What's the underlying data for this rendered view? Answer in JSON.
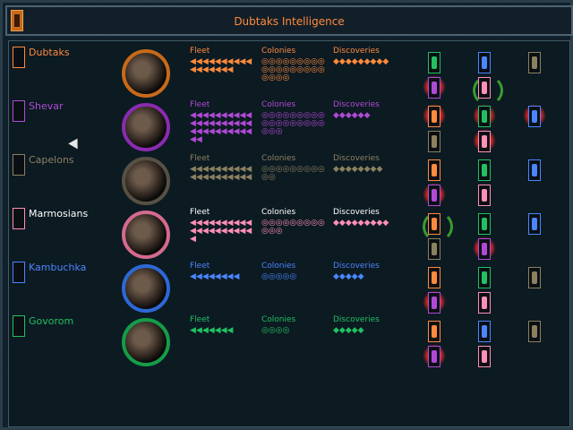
{
  "window": {
    "title": "Dubtaks Intelligence"
  },
  "columns": {
    "fleet": "Fleet",
    "colonies": "Colonies",
    "discoveries": "Discoveries"
  },
  "races": [
    {
      "name": "Dubtaks",
      "color": "#ff8a3d",
      "fleet_marks": "◀◀◀◀◀◀◀◀◀◀◀◀◀◀◀◀◀",
      "colonies_marks": "◎◎◎◎◎◎◎◎◎◎◎◎◎◎◎◎◎◎◎◎◎◎",
      "discoveries_marks": "◆◆◆◆◆◆◆◆◆"
    },
    {
      "name": "Shevar",
      "color": "#b04ad6",
      "fleet_marks": "◀◀◀◀◀◀◀◀◀◀◀◀◀◀◀◀◀◀◀◀◀◀◀◀◀◀◀◀◀◀◀◀",
      "colonies_marks": "◎◎◎◎◎◎◎◎◎◎◎◎◎◎◎◎◎◎◎◎◎",
      "discoveries_marks": "◆◆◆◆◆◆"
    },
    {
      "name": "Capelons",
      "color": "#8b8160",
      "fleet_marks": "◀◀◀◀◀◀◀◀◀◀◀◀◀◀◀◀◀◀◀◀",
      "colonies_marks": "◎◎◎◎◎◎◎◎◎◎◎",
      "discoveries_marks": "◆◆◆◆◆◆◆◆"
    },
    {
      "name": "Marmosians",
      "color": "#ff8fb6",
      "fleet_marks": "◀◀◀◀◀◀◀◀◀◀◀◀◀◀◀◀◀◀◀◀◀",
      "colonies_marks": "◎◎◎◎◎◎◎◎◎◎◎◎",
      "discoveries_marks": "◆◆◆◆◆◆◆◆◆"
    },
    {
      "name": "Kambuchka",
      "color": "#4a86ff",
      "fleet_marks": "◀◀◀◀◀◀◀◀",
      "colonies_marks": "◎◎◎◎◎",
      "discoveries_marks": "◆◆◆◆◆"
    },
    {
      "name": "Govorom",
      "color": "#22c061",
      "fleet_marks": "◀◀◀◀◀◀◀",
      "colonies_marks": "◎◎◎◎",
      "discoveries_marks": "◆◆◆◆◆"
    }
  ],
  "relations_icons": [
    [
      "orange-race-icon",
      "blue-race-icon",
      "tan-race-icon",
      "purple-race-icon",
      "pink-race-icon"
    ],
    [
      "orange-race-icon",
      "green-race-icon",
      "blue-race-icon",
      "tan-race-icon",
      "pink-race-icon"
    ],
    [
      "orange-race-icon",
      "green-race-icon",
      "blue-race-icon",
      "purple-race-icon",
      "pink-race-icon"
    ],
    [
      "orange-race-icon",
      "green-race-icon",
      "blue-race-icon",
      "tan-race-icon",
      "purple-race-icon"
    ],
    [
      "orange-race-icon",
      "green-race-icon",
      "tan-race-icon",
      "purple-race-icon",
      "pink-race-icon"
    ],
    [
      "orange-race-icon",
      "blue-race-icon",
      "tan-race-icon",
      "purple-race-icon",
      "pink-race-icon"
    ]
  ]
}
